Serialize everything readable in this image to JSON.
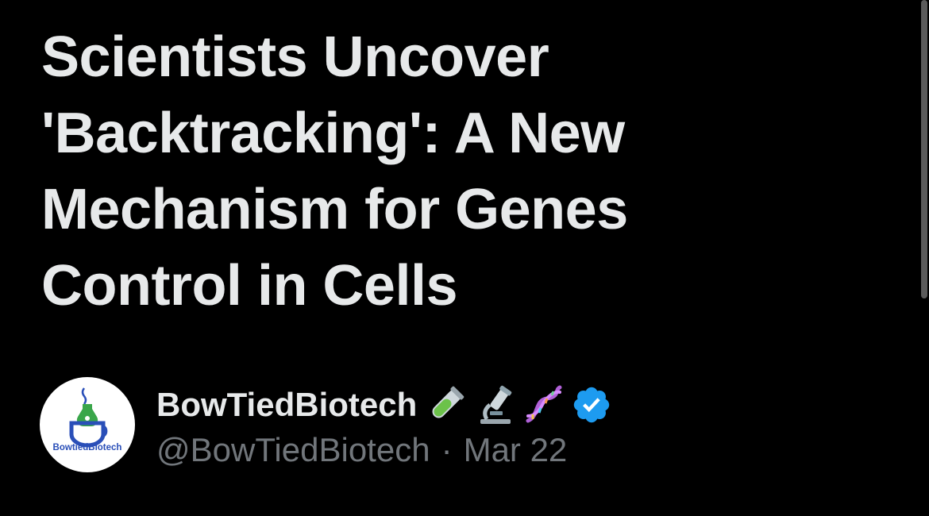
{
  "post": {
    "headline_lines": [
      "Scientists Uncover",
      "'Backtracking': A New",
      "Mechanism for Genes",
      "Control in Cells"
    ]
  },
  "author": {
    "display_name": "BowTiedBiotech",
    "emojis": [
      "test-tube",
      "microscope",
      "dna"
    ],
    "verified": true,
    "handle": "@BowTiedBiotech",
    "separator": "·",
    "date": "Mar 22",
    "avatar": {
      "logo_text": "BowtiedBiotech",
      "icon": "cup-with-leaf"
    }
  },
  "colors": {
    "background": "#000000",
    "text_primary": "#e7e9ea",
    "text_secondary": "#71767b",
    "verified_blue": "#1d9bf0",
    "logo_blue": "#2a4fb8",
    "logo_green": "#3aa64a"
  }
}
